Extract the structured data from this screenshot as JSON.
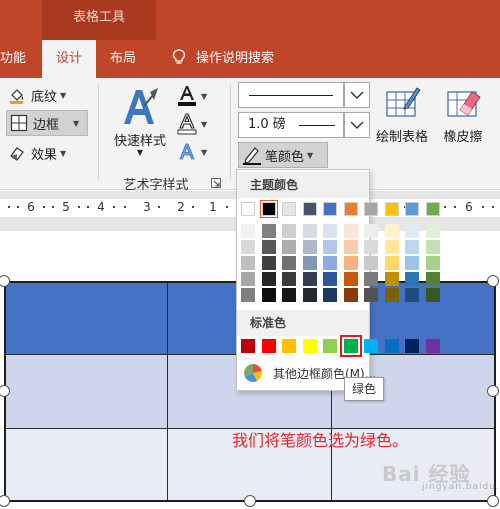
{
  "title_bar": {
    "contextual_header": "表格工具",
    "color": "#c0462a"
  },
  "tabs": {
    "func_partial": "功能",
    "design": "设计",
    "layout": "布局",
    "help_search": "操作说明搜索"
  },
  "ribbon": {
    "shading_label": "底纹",
    "borders_label": "边框",
    "effects_label": "效果",
    "quick_styles_label": "快速样式",
    "wordart_group_label": "艺术字样式",
    "pen_weight_value": "1.0 磅",
    "pen_color_label": "笔颜色",
    "draw_table_label": "绘制表格",
    "eraser_label": "橡皮擦"
  },
  "ruler": {
    "numbers": [
      "6",
      "5",
      "4",
      "3",
      "2",
      "1",
      "1",
      "2",
      "3",
      "4",
      "5",
      "6"
    ]
  },
  "pen_color_menu": {
    "theme_colors_title": "主题颜色",
    "standard_colors_title": "标准色",
    "more_colors_label": "其他边框颜色(M)...",
    "theme_top_row": [
      "#ffffff",
      "#000000",
      "#e7e6e6",
      "#44546a",
      "#4472c4",
      "#ed7d31",
      "#a5a5a5",
      "#ffc000",
      "#5b9bd5",
      "#70ad47"
    ],
    "theme_shades": [
      [
        "#f2f2f2",
        "#808080",
        "#d0cece",
        "#d6dce5",
        "#dae3f3",
        "#fbe5d6",
        "#ededed",
        "#fff2cc",
        "#deebf7",
        "#e2f0d9"
      ],
      [
        "#d9d9d9",
        "#595959",
        "#aeabab",
        "#adb9ca",
        "#b4c7e7",
        "#f8cbad",
        "#dbdbdb",
        "#ffe699",
        "#bdd7ee",
        "#c5e0b4"
      ],
      [
        "#bfbfbf",
        "#404040",
        "#767171",
        "#8497b0",
        "#8faadc",
        "#f4b183",
        "#c9c9c9",
        "#ffd966",
        "#9dc3e6",
        "#a9d18e"
      ],
      [
        "#a6a6a6",
        "#262626",
        "#3b3838",
        "#333f50",
        "#2f5597",
        "#c55a11",
        "#7b7b7b",
        "#bf9000",
        "#2e75b6",
        "#548235"
      ],
      [
        "#7f7f7f",
        "#0d0d0d",
        "#171616",
        "#222a35",
        "#203864",
        "#843c0c",
        "#525252",
        "#7f6000",
        "#1f4e79",
        "#385723"
      ]
    ],
    "standard_colors": [
      "#c00000",
      "#ff0000",
      "#ffc000",
      "#ffff00",
      "#92d050",
      "#00b050",
      "#00b0f0",
      "#0070c0",
      "#002060",
      "#7030a0"
    ],
    "tooltip": "绿色"
  },
  "annotation": {
    "text": "我们将笔颜色选为绿色。",
    "color": "#e0282d"
  },
  "watermark": {
    "text": "Bai 经验",
    "sub": "jingyan.baidu.com"
  },
  "table_colors": {
    "header": "#4472c4",
    "band1": "#cfd5ea",
    "band2": "#e9ebf5"
  }
}
